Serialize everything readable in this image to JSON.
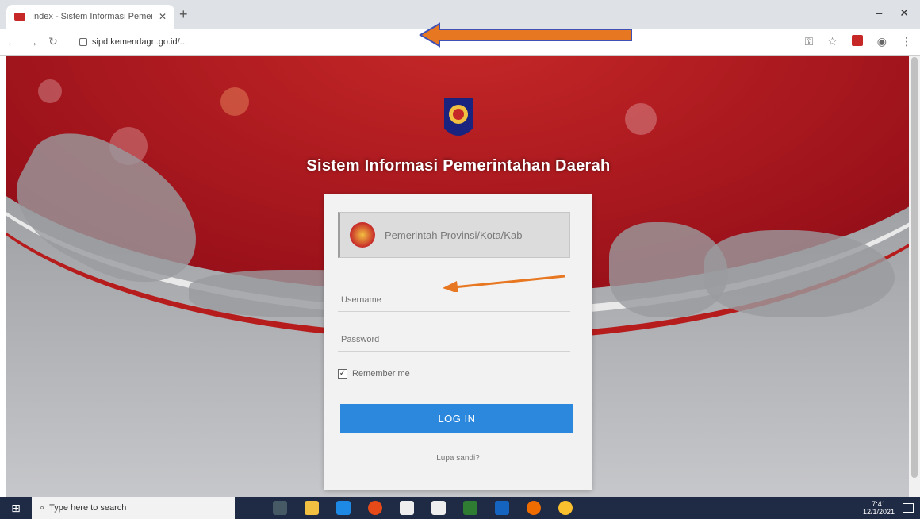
{
  "browser": {
    "tab_title": "Index - Sistem Informasi Pemerintahan Daerah",
    "tab_close": "✕",
    "new_tab": "+",
    "win_min": "‒",
    "win_close": "✕",
    "nav_back": "←",
    "nav_forward": "→",
    "nav_reload": "↻",
    "url": "sipd.kemendagri.go.id/...",
    "toolbar_star": "☆",
    "toolbar_menu": "⋮"
  },
  "page": {
    "site_title": "Sistem Informasi Pemerintahan Daerah",
    "login": {
      "pemda_label": "Pemerintah Provinsi/Kota/Kab",
      "username_placeholder": "Username",
      "password_placeholder": "Password",
      "remember_label": "Remember me",
      "remember_checked": true,
      "login_button": "LOG IN",
      "forgot_link": "Lupa sandi?"
    }
  },
  "taskbar": {
    "search_placeholder": "Type here to search",
    "clock_time": "7:41",
    "clock_date": "12/1/2021"
  },
  "colors": {
    "brand_red": "#c62828",
    "button_blue": "#2c88dd",
    "annotation_arrow": "#e87722"
  }
}
